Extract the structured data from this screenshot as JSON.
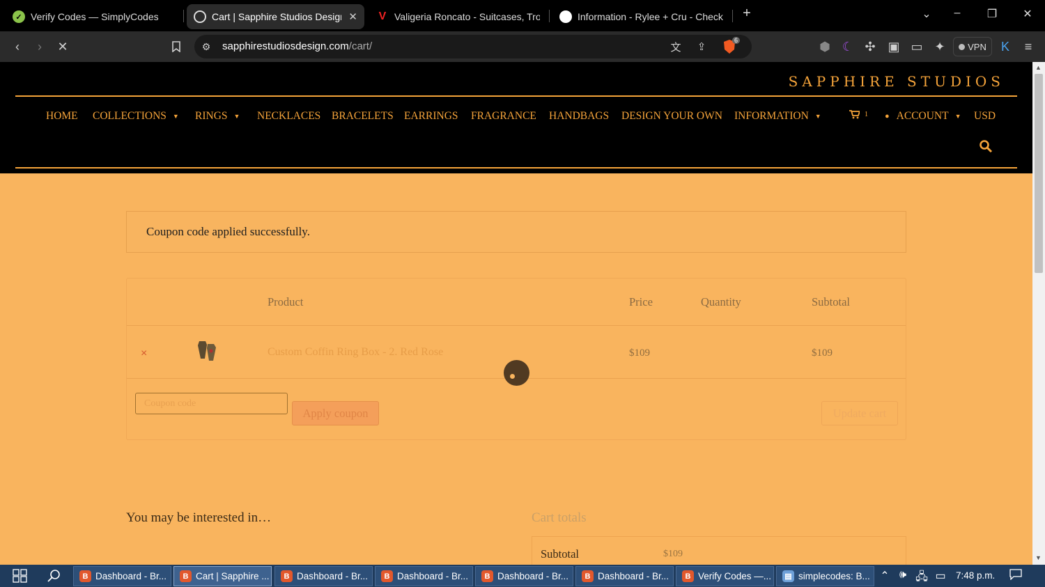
{
  "browser": {
    "tabs": [
      {
        "title": "Verify Codes — SimplyCodes",
        "active": false
      },
      {
        "title": "Cart | Sapphire Studios Design",
        "active": true
      },
      {
        "title": "Valigeria Roncato - Suitcases, Trolley",
        "active": false
      },
      {
        "title": "Information - Rylee + Cru - Checkout",
        "active": false
      }
    ],
    "url_domain": "sapphirestudiosdesign.com",
    "url_path": "/cart/",
    "vpn_label": "VPN",
    "shields_count": "6"
  },
  "site": {
    "logo": "SAPPHIRE STUDIOS",
    "nav": [
      {
        "label": "HOME",
        "dropdown": false
      },
      {
        "label": "COLLECTIONS",
        "dropdown": true
      },
      {
        "label": "RINGS",
        "dropdown": true
      },
      {
        "label": "NECKLACES",
        "dropdown": false
      },
      {
        "label": "BRACELETS",
        "dropdown": false
      },
      {
        "label": "EARRINGS",
        "dropdown": false
      },
      {
        "label": "FRAGRANCE",
        "dropdown": false
      },
      {
        "label": "HANDBAGS",
        "dropdown": false
      },
      {
        "label": "DESIGN YOUR OWN",
        "dropdown": false
      },
      {
        "label": "INFORMATION",
        "dropdown": true
      }
    ],
    "cart_count": "1",
    "account_label": "ACCOUNT",
    "currency": "USD",
    "accent_color": "#f6a43a",
    "page_bg": "#f9b45e"
  },
  "cart": {
    "notice": "Coupon code applied successfully.",
    "headers": {
      "product": "Product",
      "price": "Price",
      "quantity": "Quantity",
      "subtotal": "Subtotal"
    },
    "items": [
      {
        "name": "Custom Coffin Ring Box - 2. Red Rose",
        "price": "$109",
        "subtotal": "$109"
      }
    ],
    "coupon_placeholder": "Coupon code",
    "apply_label": "Apply coupon",
    "update_label": "Update cart"
  },
  "related": {
    "heading": "You may be interested in…"
  },
  "totals": {
    "heading": "Cart totals",
    "subtotal_label": "Subtotal",
    "subtotal_value": "$109"
  },
  "taskbar": {
    "items": [
      {
        "label": "Dashboard - Br...",
        "icon": "brave",
        "active": false
      },
      {
        "label": "Cart | Sapphire ...",
        "icon": "brave",
        "active": true
      },
      {
        "label": "Dashboard - Br...",
        "icon": "brave",
        "active": false
      },
      {
        "label": "Dashboard - Br...",
        "icon": "brave",
        "active": false
      },
      {
        "label": "Dashboard - Br...",
        "icon": "brave",
        "active": false
      },
      {
        "label": "Dashboard - Br...",
        "icon": "brave",
        "active": false
      },
      {
        "label": "Verify Codes —...",
        "icon": "brave",
        "active": false
      },
      {
        "label": "simplecodes: B...",
        "icon": "notepad",
        "active": false
      }
    ],
    "clock": "7:48 p.m."
  }
}
